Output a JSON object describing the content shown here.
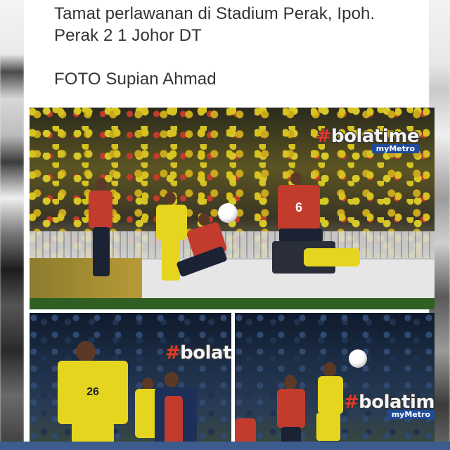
{
  "post": {
    "line1": "Tamat perlawanan di Stadium Perak, Ipoh.",
    "line2": "Perak 2   1 Johor DT",
    "line3": "",
    "line4": "FOTO Supian Ahmad"
  },
  "photos": [
    {
      "watermark_hash": "#",
      "watermark_text": "bolatime",
      "watermark_sub": "myMetro",
      "jersey_number": "6"
    },
    {
      "watermark_hash": "#",
      "watermark_text": "bolat",
      "jersey_number": "26"
    },
    {
      "watermark_hash": "#",
      "watermark_text": "bolatim",
      "watermark_sub": "myMetro"
    }
  ],
  "colors": {
    "text": "#333333",
    "card": "#ffffff",
    "bar": "#3b5c8c",
    "perak_kit": "#e6d51f",
    "jdt_kit": "#c23b2c"
  }
}
